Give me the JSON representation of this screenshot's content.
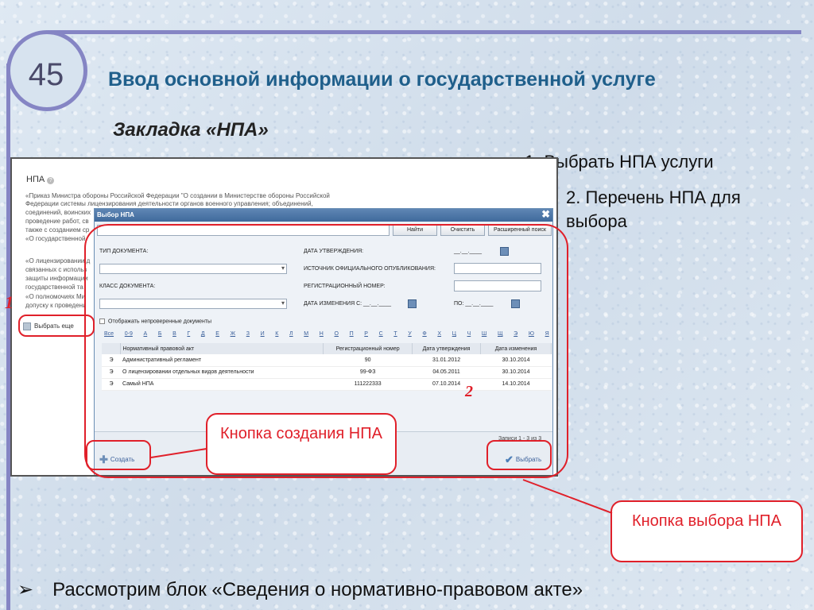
{
  "slide": {
    "number": "45",
    "title": "Ввод основной информации о государственной услуге",
    "subtitle": "Закладка «НПА»",
    "step1": "1. Выбрать НПА услуги",
    "step2": "2. Перечень НПА для выбора",
    "bottom_bullet": "➢",
    "bottom_text": "Рассмотрим блок «Сведения о нормативно-правовом акте»"
  },
  "bg_page": {
    "heading": "НПА",
    "lines": [
      "«Приказ Министра обороны Российской Федерации \"О создании в Министерстве обороны Российской",
      "Федерации системы лицензирования деятельности органов военного управления; объединений,",
      "соединений, воинских",
      "проведение работ, св",
      "также с созданием ср",
      "«О государственной",
      "«О лицензировании д",
      "связанных с использ",
      "защиты информации",
      "государственной та",
      "«О полномочиях Ми",
      "допуску к проведени"
    ],
    "choose_more": "Выбрать еще"
  },
  "dialog": {
    "title": "Выбор НПА",
    "close": "✖",
    "find": "Найти",
    "clear": "Очистить",
    "advanced": "Расширенный поиск",
    "doc_type": "ТИП ДОКУМЕНТА:",
    "doc_class": "КЛАСС ДОКУМЕНТА:",
    "approval_date": "ДАТА УТВЕРЖДЕНИЯ:",
    "approval_date_val": "__.__.____",
    "official_source": "ИСТОЧНИК ОФИЦИАЛЬНОГО ОПУБЛИКОВАНИЯ:",
    "reg_number": "РЕГИСТРАЦИОННЫЙ НОМЕР:",
    "change_date_from": "ДАТА ИЗМЕНЕНИЯ С: __.__.____",
    "change_date_to": "ПО: __.__.____",
    "show_unverified": "Отображать непроверенные документы",
    "letters": [
      "Все",
      "0-9",
      "А",
      "Б",
      "В",
      "Г",
      "Д",
      "Е",
      "Ж",
      "З",
      "И",
      "К",
      "Л",
      "М",
      "Н",
      "О",
      "П",
      "Р",
      "С",
      "Т",
      "У",
      "Ф",
      "Х",
      "Ц",
      "Ч",
      "Ш",
      "Щ",
      "Э",
      "Ю",
      "Я"
    ],
    "columns": [
      "Нормативный правовой акт",
      "Регистрационный номер",
      "Дата утверждения",
      "Дата изменения"
    ],
    "rows": [
      {
        "mark": "Э",
        "name": "Административный регламент",
        "reg": "90",
        "approved": "31.01.2012",
        "changed": "30.10.2014"
      },
      {
        "mark": "Э",
        "name": "О лицензировании отдельных видов деятельности",
        "reg": "99-ФЗ",
        "approved": "04.05.2011",
        "changed": "30.10.2014"
      },
      {
        "mark": "Э",
        "name": "Самый НПА",
        "reg": "111222333",
        "approved": "07.10.2014",
        "changed": "14.10.2014"
      }
    ],
    "records": "Записи 1 - 3 из 3",
    "create": "Создать",
    "select": "Выбрать"
  },
  "annotations": {
    "label1": "1",
    "label2": "2",
    "create_callout": "Кнопка создания НПА",
    "select_callout": "Кнопка выбора НПА"
  },
  "colors": {
    "accent_red": "#e0202a",
    "title_blue": "#1f5f8b",
    "frame": "#8585c4"
  }
}
